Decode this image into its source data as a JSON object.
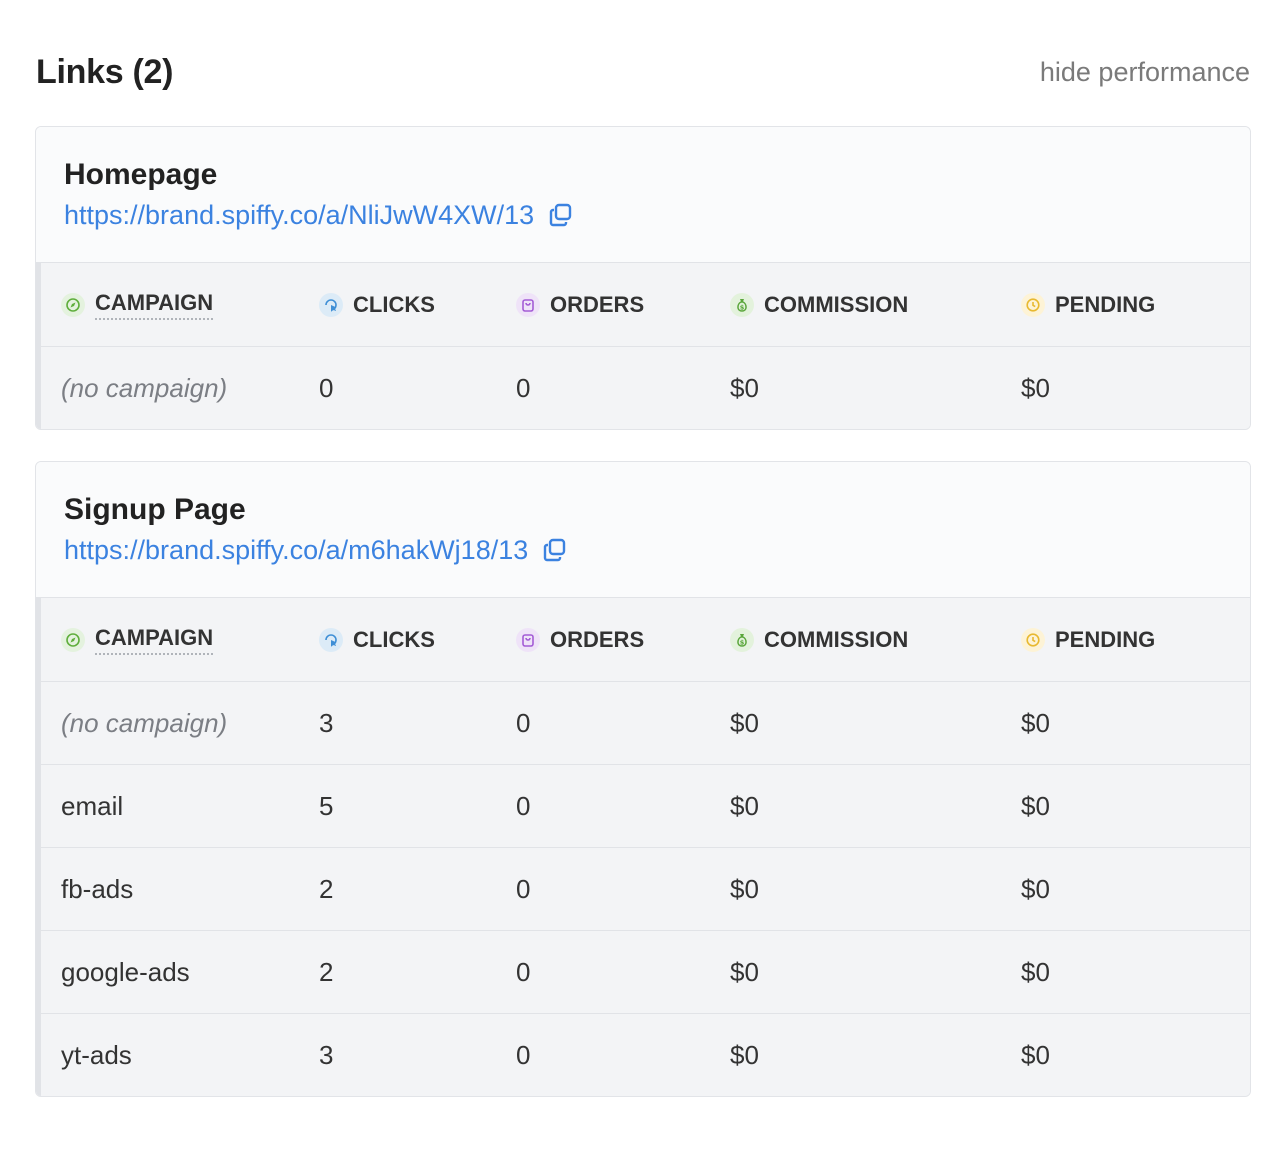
{
  "header": {
    "title": "Links (2)",
    "toggle_label": "hide performance"
  },
  "columns": {
    "campaign": "CAMPAIGN",
    "clicks": "CLICKS",
    "orders": "ORDERS",
    "commission": "COMMISSION",
    "pending": "PENDING"
  },
  "icons": {
    "campaign": "compass-icon",
    "clicks": "cursor-click-icon",
    "orders": "shopping-bag-icon",
    "commission": "money-bag-icon",
    "pending": "clock-icon",
    "copy": "copy-icon"
  },
  "colors": {
    "link": "#3b82e0",
    "campaign_icon": "#5fae3c",
    "clicks_icon": "#3f8fd6",
    "orders_icon": "#a45cd6",
    "commission_icon": "#5aa63b",
    "pending_icon": "#e8b930"
  },
  "links": [
    {
      "name": "Homepage",
      "url": "https://brand.spiffy.co/a/NliJwW4XW/13",
      "rows": [
        {
          "campaign": "(no campaign)",
          "clicks": "0",
          "orders": "0",
          "commission": "$0",
          "pending": "$0"
        }
      ]
    },
    {
      "name": "Signup Page",
      "url": "https://brand.spiffy.co/a/m6hakWj18/13",
      "rows": [
        {
          "campaign": "(no campaign)",
          "clicks": "3",
          "orders": "0",
          "commission": "$0",
          "pending": "$0"
        },
        {
          "campaign": "email",
          "clicks": "5",
          "orders": "0",
          "commission": "$0",
          "pending": "$0"
        },
        {
          "campaign": "fb-ads",
          "clicks": "2",
          "orders": "0",
          "commission": "$0",
          "pending": "$0"
        },
        {
          "campaign": "google-ads",
          "clicks": "2",
          "orders": "0",
          "commission": "$0",
          "pending": "$0"
        },
        {
          "campaign": "yt-ads",
          "clicks": "3",
          "orders": "0",
          "commission": "$0",
          "pending": "$0"
        }
      ]
    }
  ]
}
